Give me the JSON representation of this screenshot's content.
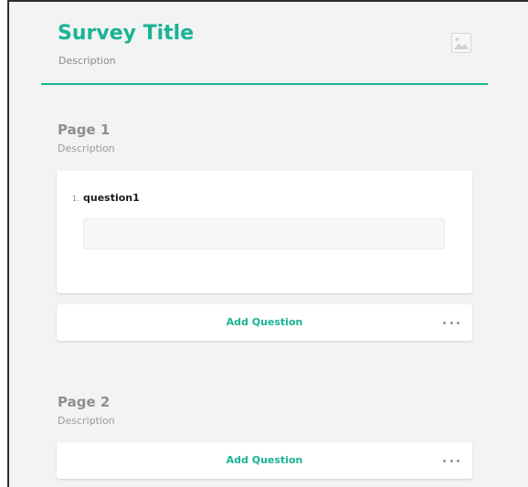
{
  "survey": {
    "title": "Survey Title",
    "description": "Description"
  },
  "pages": [
    {
      "title": "Page 1",
      "description": "Description",
      "questions": [
        {
          "number": "1.",
          "title": "question1",
          "value": ""
        }
      ],
      "add_question_label": "Add Question"
    },
    {
      "title": "Page 2",
      "description": "Description",
      "add_question_label": "Add Question"
    }
  ],
  "icons": {
    "logo": "image-placeholder-icon",
    "more": "more-horizontal-icon"
  },
  "colors": {
    "accent": "#19b394",
    "background": "#f3f3f3"
  }
}
